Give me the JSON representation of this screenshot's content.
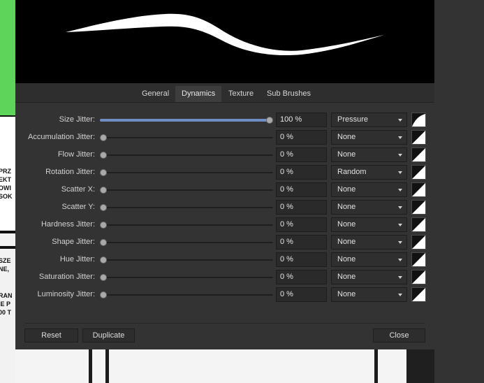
{
  "tabs": [
    {
      "label": "General",
      "active": false
    },
    {
      "label": "Dynamics",
      "active": true
    },
    {
      "label": "Texture",
      "active": false
    },
    {
      "label": "Sub Brushes",
      "active": false
    }
  ],
  "rows": [
    {
      "label": "Size Jitter:",
      "value": "100 %",
      "percent": 100,
      "controller": "Pressure"
    },
    {
      "label": "Accumulation Jitter:",
      "value": "0 %",
      "percent": 0,
      "controller": "None"
    },
    {
      "label": "Flow Jitter:",
      "value": "0 %",
      "percent": 0,
      "controller": "None"
    },
    {
      "label": "Rotation Jitter:",
      "value": "0 %",
      "percent": 0,
      "controller": "Random"
    },
    {
      "label": "Scatter X:",
      "value": "0 %",
      "percent": 0,
      "controller": "None"
    },
    {
      "label": "Scatter Y:",
      "value": "0 %",
      "percent": 0,
      "controller": "None"
    },
    {
      "label": "Hardness Jitter:",
      "value": "0 %",
      "percent": 0,
      "controller": "None"
    },
    {
      "label": "Shape Jitter:",
      "value": "0 %",
      "percent": 0,
      "controller": "None"
    },
    {
      "label": "Hue Jitter:",
      "value": "0 %",
      "percent": 0,
      "controller": "None"
    },
    {
      "label": "Saturation Jitter:",
      "value": "0 %",
      "percent": 0,
      "controller": "None"
    },
    {
      "label": "Luminosity Jitter:",
      "value": "0 %",
      "percent": 0,
      "controller": "None"
    }
  ],
  "buttons": {
    "reset": "Reset",
    "duplicate": "Duplicate",
    "close": "Close"
  },
  "background_text": [
    "PRZ",
    "EKT",
    "OWI",
    "SOK",
    "SZE",
    "NE,",
    "RAN",
    "IE P",
    "00 T"
  ],
  "colors": {
    "slider_fill": "#6f8fc4",
    "panel_bg": "#333333",
    "preview_bg": "#000000"
  }
}
